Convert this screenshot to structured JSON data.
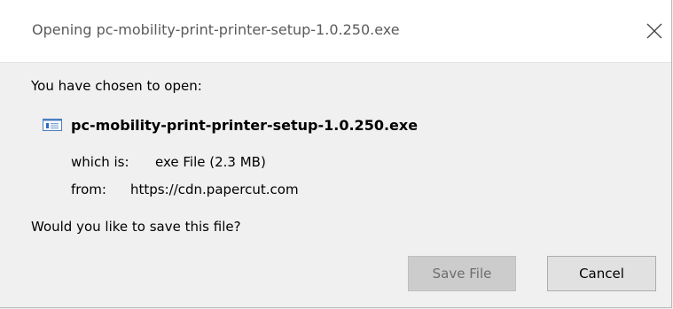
{
  "dialog": {
    "title": "Opening pc-mobility-print-printer-setup-1.0.250.exe",
    "close_icon": "close-icon",
    "prompt": "You have chosen to open:",
    "file": {
      "icon": "exe-file-icon",
      "name": "pc-mobility-print-printer-setup-1.0.250.exe",
      "type_label": "which is:",
      "type_value": "exe File (2.3 MB)",
      "from_label": "from:",
      "from_value": "https://cdn.papercut.com"
    },
    "question": "Would you like to save this file?",
    "buttons": {
      "save_label": "Save File",
      "cancel_label": "Cancel"
    }
  }
}
